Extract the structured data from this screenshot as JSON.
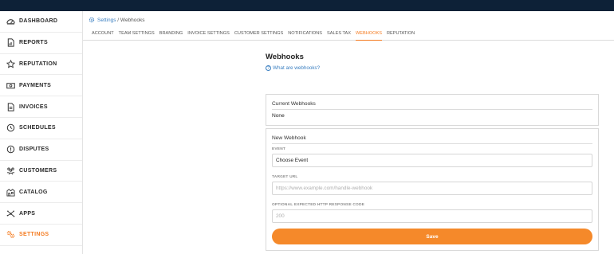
{
  "sidebar": {
    "items": [
      {
        "label": "DASHBOARD",
        "icon": "dashboard-icon"
      },
      {
        "label": "REPORTS",
        "icon": "report-icon"
      },
      {
        "label": "REPUTATION",
        "icon": "star-icon"
      },
      {
        "label": "PAYMENTS",
        "icon": "payments-icon"
      },
      {
        "label": "INVOICES",
        "icon": "invoice-icon"
      },
      {
        "label": "SCHEDULES",
        "icon": "clock-icon"
      },
      {
        "label": "DISPUTES",
        "icon": "alert-icon"
      },
      {
        "label": "CUSTOMERS",
        "icon": "customers-icon"
      },
      {
        "label": "CATALOG",
        "icon": "catalog-icon"
      },
      {
        "label": "APPS",
        "icon": "apps-icon"
      },
      {
        "label": "SETTINGS",
        "icon": "settings-icon",
        "active": true
      }
    ]
  },
  "breadcrumb": {
    "parent": "Settings",
    "separator": " / ",
    "current": "Webhooks"
  },
  "tabs": [
    {
      "label": "ACCOUNT"
    },
    {
      "label": "TEAM SETTINGS"
    },
    {
      "label": "BRANDING"
    },
    {
      "label": "INVOICE SETTINGS"
    },
    {
      "label": "CUSTOMER SETTINGS"
    },
    {
      "label": "NOTIFICATIONS"
    },
    {
      "label": "SALES TAX"
    },
    {
      "label": "WEBHOOKS",
      "active": true
    },
    {
      "label": "REPUTATION"
    }
  ],
  "page": {
    "title": "Webhooks",
    "help_link": "What are webhooks?",
    "current": {
      "title": "Current Webhooks",
      "value": "None"
    },
    "new": {
      "title": "New Webhook",
      "event": {
        "label": "EVENT",
        "value": "Choose Event"
      },
      "target_url": {
        "label": "TARGET URL",
        "placeholder": "https://www.example.com/handle-webhook"
      },
      "response_code": {
        "label": "OPTIONAL EXPECTED HTTP RESPONSE CODE",
        "placeholder": "200"
      },
      "save_label": "Save"
    }
  },
  "colors": {
    "accent": "#f47b20",
    "link": "#3a7fc1",
    "topbar": "#0d2137",
    "button": "#f5892a"
  }
}
